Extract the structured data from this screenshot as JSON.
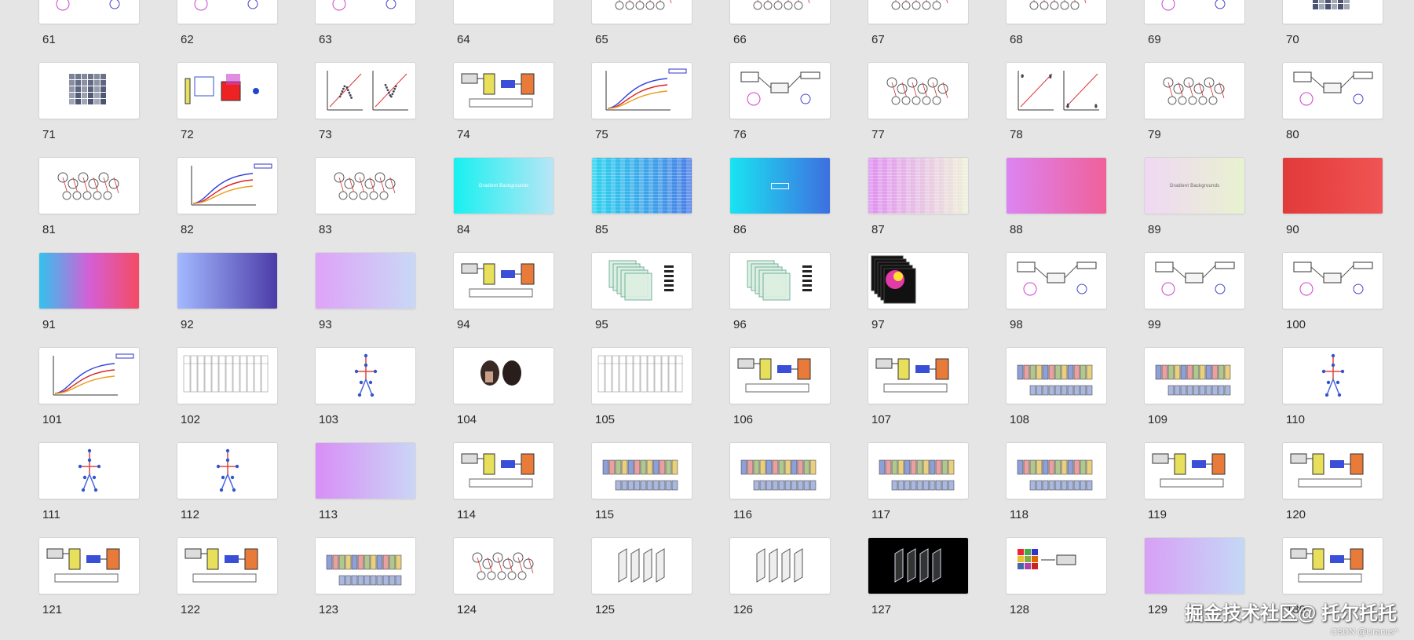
{
  "slides": [
    {
      "n": "61",
      "kind": "diagram"
    },
    {
      "n": "62",
      "kind": "diagram"
    },
    {
      "n": "63",
      "kind": "diagram"
    },
    {
      "n": "64",
      "kind": "blank"
    },
    {
      "n": "65",
      "kind": "network"
    },
    {
      "n": "66",
      "kind": "network"
    },
    {
      "n": "67",
      "kind": "network"
    },
    {
      "n": "68",
      "kind": "network"
    },
    {
      "n": "69",
      "kind": "diagram"
    },
    {
      "n": "70",
      "kind": "matrix"
    },
    {
      "n": "71",
      "kind": "matrix"
    },
    {
      "n": "72",
      "kind": "cube"
    },
    {
      "n": "73",
      "kind": "scatter"
    },
    {
      "n": "74",
      "kind": "flow"
    },
    {
      "n": "75",
      "kind": "curve"
    },
    {
      "n": "76",
      "kind": "diagram"
    },
    {
      "n": "77",
      "kind": "network"
    },
    {
      "n": "78",
      "kind": "scatter"
    },
    {
      "n": "79",
      "kind": "network"
    },
    {
      "n": "80",
      "kind": "diagram"
    },
    {
      "n": "81",
      "kind": "network"
    },
    {
      "n": "82",
      "kind": "curve"
    },
    {
      "n": "83",
      "kind": "network"
    },
    {
      "n": "84",
      "kind": "gradient",
      "bg": "linear-gradient(90deg,#18f0f0,#b8e6f6)",
      "title": "Gradient Backgrounds",
      "style": "light"
    },
    {
      "n": "85",
      "kind": "gradient",
      "bg": "linear-gradient(90deg,#2ad2ee,#4a7ee6)",
      "title": "",
      "style": "stripes"
    },
    {
      "n": "86",
      "kind": "gradient",
      "bg": "linear-gradient(90deg,#19e4f2,#3e6fe0)",
      "title": "",
      "style": "box"
    },
    {
      "n": "87",
      "kind": "gradient",
      "bg": "linear-gradient(90deg,#df8ef0,#eef0d8)",
      "title": "",
      "style": "stripes"
    },
    {
      "n": "88",
      "kind": "gradient",
      "bg": "linear-gradient(90deg,#dc84f2,#f0609a)",
      "title": "",
      "style": "plain"
    },
    {
      "n": "89",
      "kind": "gradient",
      "bg": "linear-gradient(90deg,#f0d8f4,#e8f2d0)",
      "title": "Gradient Backgrounds",
      "style": "dark"
    },
    {
      "n": "90",
      "kind": "gradient",
      "bg": "linear-gradient(90deg,#e23a3a,#f05454)",
      "title": "",
      "style": "plain"
    },
    {
      "n": "91",
      "kind": "gradient",
      "bg": "linear-gradient(90deg,#33c2ee,#d45fd6,#f44b64)",
      "title": "",
      "style": "plain"
    },
    {
      "n": "92",
      "kind": "gradient",
      "bg": "linear-gradient(90deg,#a3b9ff,#4c3ca8)",
      "title": "",
      "style": "plain"
    },
    {
      "n": "93",
      "kind": "gradient",
      "bg": "linear-gradient(90deg,#dea3f8,#c9d8f6)",
      "title": "",
      "style": "light"
    },
    {
      "n": "94",
      "kind": "flow"
    },
    {
      "n": "95",
      "kind": "stack"
    },
    {
      "n": "96",
      "kind": "stack"
    },
    {
      "n": "97",
      "kind": "heat"
    },
    {
      "n": "98",
      "kind": "diagram"
    },
    {
      "n": "99",
      "kind": "diagram"
    },
    {
      "n": "100",
      "kind": "diagram"
    },
    {
      "n": "101",
      "kind": "curve"
    },
    {
      "n": "102",
      "kind": "table"
    },
    {
      "n": "103",
      "kind": "pose"
    },
    {
      "n": "104",
      "kind": "photo"
    },
    {
      "n": "105",
      "kind": "table"
    },
    {
      "n": "106",
      "kind": "flow"
    },
    {
      "n": "107",
      "kind": "flow"
    },
    {
      "n": "108",
      "kind": "blocks"
    },
    {
      "n": "109",
      "kind": "blocks"
    },
    {
      "n": "110",
      "kind": "pose"
    },
    {
      "n": "111",
      "kind": "pose"
    },
    {
      "n": "112",
      "kind": "pose"
    },
    {
      "n": "113",
      "kind": "gradient",
      "bg": "linear-gradient(90deg,#d88ef6,#cad6f6)",
      "title": "",
      "style": "light"
    },
    {
      "n": "114",
      "kind": "flow"
    },
    {
      "n": "115",
      "kind": "blocks"
    },
    {
      "n": "116",
      "kind": "blocks"
    },
    {
      "n": "117",
      "kind": "blocks"
    },
    {
      "n": "118",
      "kind": "blocks"
    },
    {
      "n": "119",
      "kind": "flow"
    },
    {
      "n": "120",
      "kind": "flow"
    },
    {
      "n": "121",
      "kind": "flow"
    },
    {
      "n": "122",
      "kind": "flow"
    },
    {
      "n": "123",
      "kind": "blocks"
    },
    {
      "n": "124",
      "kind": "network"
    },
    {
      "n": "125",
      "kind": "planes"
    },
    {
      "n": "126",
      "kind": "planes"
    },
    {
      "n": "127",
      "kind": "planesdark"
    },
    {
      "n": "128",
      "kind": "grid4"
    },
    {
      "n": "129",
      "kind": "gradient",
      "bg": "linear-gradient(90deg,#d8a0f6,#c4d8f6)",
      "title": "",
      "style": "light"
    },
    {
      "n": "130",
      "kind": "flow"
    }
  ],
  "watermark": "掘金技术社区@ 托尔托托",
  "credit": "CSDN @Uranus^"
}
